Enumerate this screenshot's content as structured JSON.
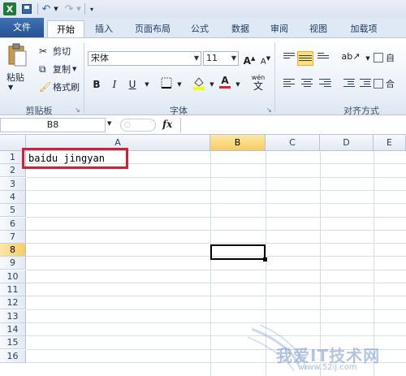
{
  "quick_access": {
    "logo": "X",
    "undo": "↶",
    "redo": "↷"
  },
  "tabs": [
    {
      "label": "文件"
    },
    {
      "label": "开始"
    },
    {
      "label": "插入"
    },
    {
      "label": "页面布局"
    },
    {
      "label": "公式"
    },
    {
      "label": "数据"
    },
    {
      "label": "审阅"
    },
    {
      "label": "视图"
    },
    {
      "label": "加载项"
    }
  ],
  "clipboard": {
    "paste": "粘贴",
    "cut": "剪切",
    "copy": "复制",
    "format_painter": "格式刷",
    "group": "剪贴板"
  },
  "font": {
    "name": "宋体",
    "size": "11",
    "bold": "B",
    "italic": "I",
    "underline": "U",
    "grow": "A",
    "shrink": "A",
    "group": "字体",
    "wen": "wén",
    "wen_char": "文"
  },
  "alignment": {
    "group": "对齐方式",
    "wrap": "自",
    "merge": "合"
  },
  "formula_bar": {
    "name_box": "B8",
    "fx": "fx"
  },
  "columns": [
    "A",
    "B",
    "C",
    "D",
    "E"
  ],
  "rows": [
    "1",
    "2",
    "3",
    "4",
    "5",
    "6",
    "7",
    "8",
    "9",
    "10",
    "11",
    "12",
    "13",
    "14",
    "15",
    "16"
  ],
  "cells": {
    "A1": "baidu jingyan"
  },
  "selected_cell": "B8",
  "watermark": {
    "text": "我爱IT技术网",
    "url": "www.52ij.com"
  },
  "colors": {
    "accent": "#2b5797",
    "highlight": "#c8243c",
    "selection_header": "#f8cc64"
  }
}
